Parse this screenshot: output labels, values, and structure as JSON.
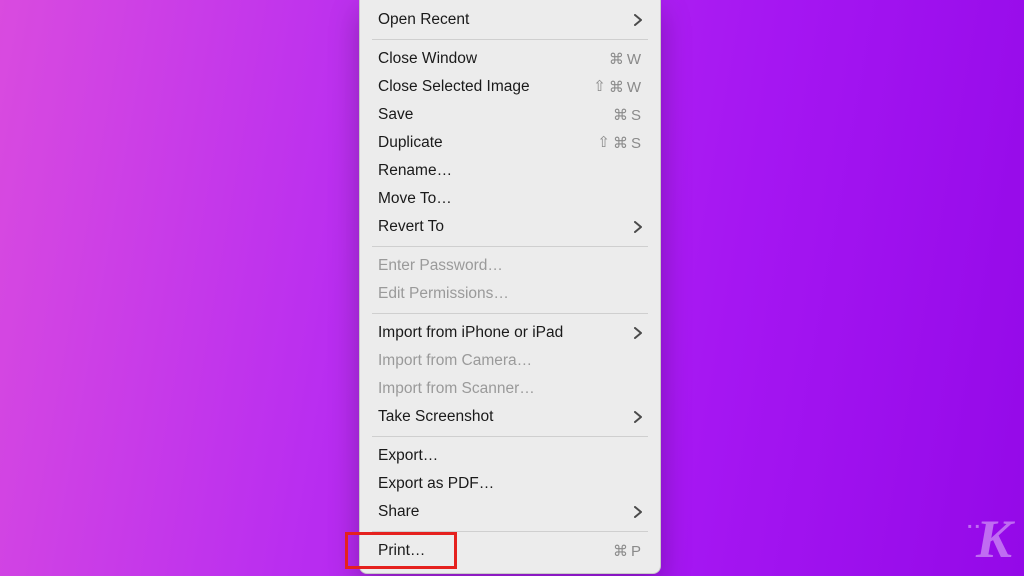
{
  "watermark": {
    "text": "K"
  },
  "highlight": {
    "target_index": 17
  },
  "menu": {
    "groups": [
      [
        {
          "label": "Open Recent",
          "submenu": true
        }
      ],
      [
        {
          "label": "Close Window",
          "shortcut": "⌘ W"
        },
        {
          "label": "Close Selected Image",
          "shortcut": "⇧ ⌘ W"
        },
        {
          "label": "Save",
          "shortcut": "⌘ S"
        },
        {
          "label": "Duplicate",
          "shortcut": "⇧ ⌘ S"
        },
        {
          "label": "Rename…"
        },
        {
          "label": "Move To…"
        },
        {
          "label": "Revert To",
          "submenu": true
        }
      ],
      [
        {
          "label": "Enter Password…",
          "disabled": true
        },
        {
          "label": "Edit Permissions…",
          "disabled": true
        }
      ],
      [
        {
          "label": "Import from iPhone or iPad",
          "submenu": true
        },
        {
          "label": "Import from Camera…",
          "disabled": true
        },
        {
          "label": "Import from Scanner…",
          "disabled": true
        },
        {
          "label": "Take Screenshot",
          "submenu": true
        }
      ],
      [
        {
          "label": "Export…"
        },
        {
          "label": "Export as PDF…"
        },
        {
          "label": "Share",
          "submenu": true
        }
      ],
      [
        {
          "label": "Print…",
          "shortcut": "⌘ P"
        }
      ]
    ]
  }
}
